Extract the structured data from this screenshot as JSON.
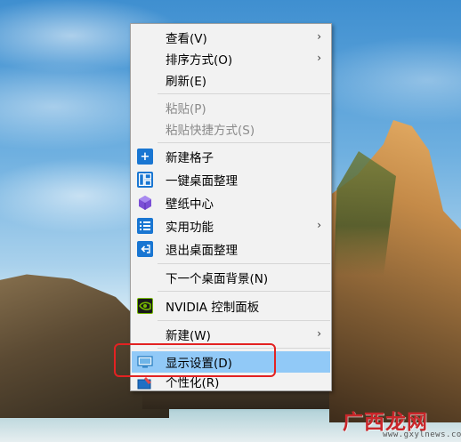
{
  "menu": {
    "items": [
      {
        "label": "查看(V)",
        "submenu": true,
        "disabled": false
      },
      {
        "label": "排序方式(O)",
        "submenu": true,
        "disabled": false
      },
      {
        "label": "刷新(E)",
        "submenu": false,
        "disabled": false
      },
      {
        "label": "粘贴(P)",
        "submenu": false,
        "disabled": true
      },
      {
        "label": "粘贴快捷方式(S)",
        "submenu": false,
        "disabled": true
      },
      {
        "label": "新建格子",
        "submenu": false,
        "disabled": false,
        "icon": "plus-icon"
      },
      {
        "label": "一键桌面整理",
        "submenu": false,
        "disabled": false,
        "icon": "layout-icon"
      },
      {
        "label": "壁纸中心",
        "submenu": false,
        "disabled": false,
        "icon": "cube-icon"
      },
      {
        "label": "实用功能",
        "submenu": true,
        "disabled": false,
        "icon": "list-icon"
      },
      {
        "label": "退出桌面整理",
        "submenu": false,
        "disabled": false,
        "icon": "exit-icon"
      },
      {
        "label": "下一个桌面背景(N)",
        "submenu": false,
        "disabled": false
      },
      {
        "label": "NVIDIA 控制面板",
        "submenu": false,
        "disabled": false,
        "icon": "nvidia-icon"
      },
      {
        "label": "新建(W)",
        "submenu": true,
        "disabled": false
      },
      {
        "label": "显示设置(D)",
        "submenu": false,
        "disabled": false,
        "icon": "display-icon",
        "highlighted": true
      },
      {
        "label": "个性化(R)",
        "submenu": false,
        "disabled": false,
        "icon": "personalize-icon"
      }
    ]
  },
  "watermark": {
    "logo": "广西龙网",
    "url": "www.gxylnews.com"
  },
  "colors": {
    "menu_bg": "#f2f2f2",
    "highlight": "#91c9f7",
    "annotation": "#e32222",
    "icon_blue": "#1976d2"
  }
}
